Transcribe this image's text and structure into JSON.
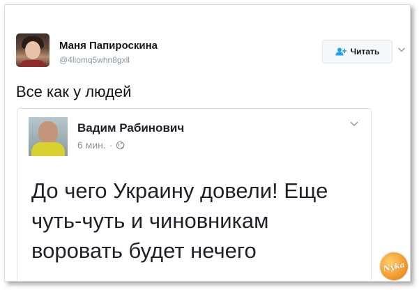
{
  "tweet": {
    "user_name": "Маня Папироскина",
    "user_handle": "@4liomq5whn8gxll",
    "follow_label": "Читать",
    "text": "Все как у людей"
  },
  "embedded_post": {
    "author": "Вадим Рабинович",
    "time": "6 мин.",
    "separator": "·",
    "body_lines": [
      "До чего Украину довели! Еще",
      "чуть-чуть и чиновникам",
      "воровать будет нечего"
    ]
  },
  "watermark": {
    "text": "Nyka"
  },
  "colors": {
    "accent": "#1da1f2",
    "text": "#14171a",
    "muted": "#8899a6",
    "logo": "#f29a2e"
  },
  "icons": {
    "follow": "add-user-icon",
    "menu": "chevron-down-icon",
    "privacy": "globe-icon"
  }
}
